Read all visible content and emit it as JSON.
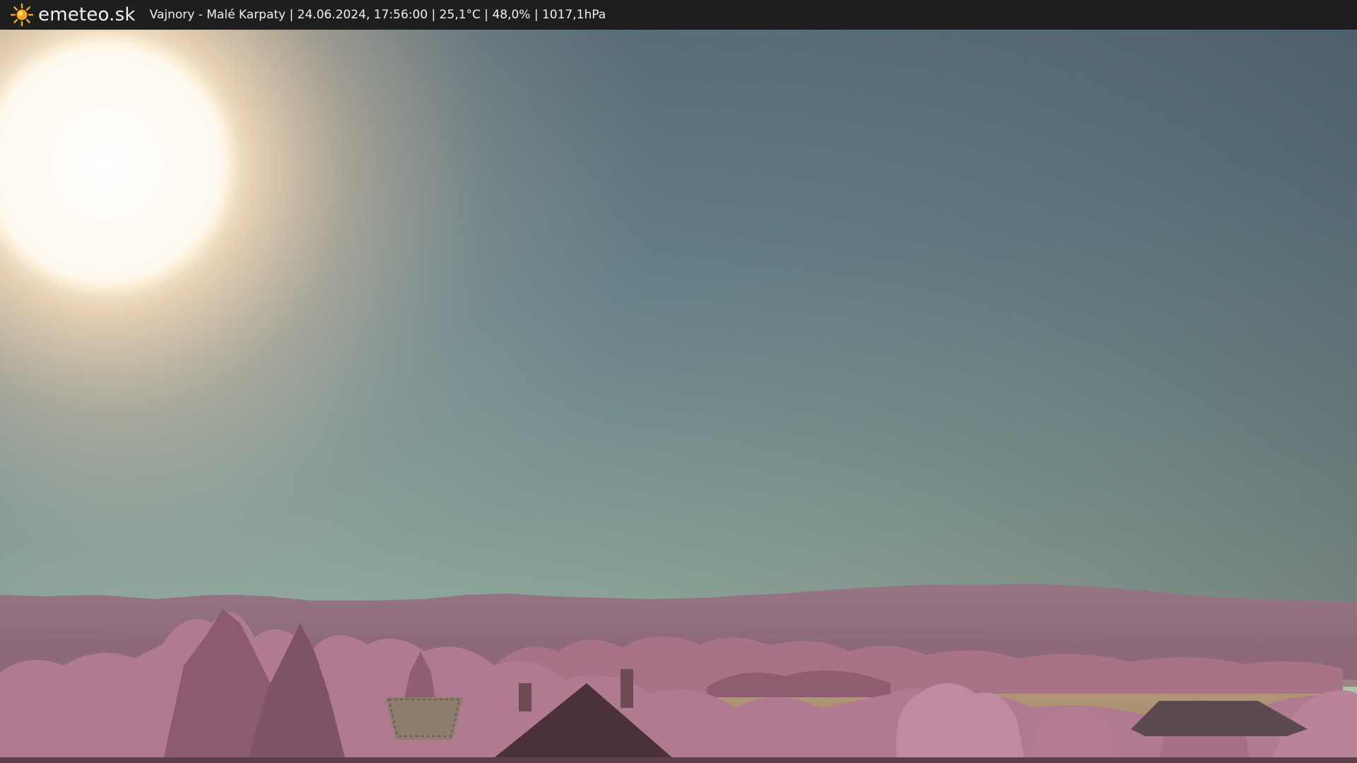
{
  "header": {
    "brand": "emeteo.sk",
    "logo_icon": "sun-icon",
    "status_line": "Vajnory - Malé Karpaty | 24.06.2024, 17:56:00 | 25,1°C | 48,0% | 1017,1hPa"
  },
  "colors": {
    "bar_background": "#1e1e1e",
    "sun_icon": "#f5a623",
    "sky_top": "#4f5f6e",
    "sky_horizon": "#a9bfa8",
    "vegetation": "#b78092"
  }
}
